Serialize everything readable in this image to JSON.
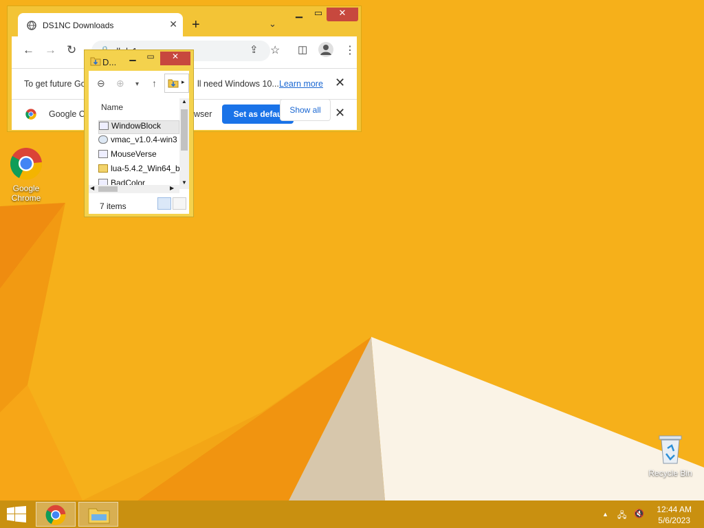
{
  "desktop": {
    "icons": [
      {
        "label": "Google Chrome",
        "icon": "chrome-icon"
      },
      {
        "label": "Recycle Bin",
        "icon": "recycle-bin-icon"
      }
    ]
  },
  "chrome": {
    "tab_title": "DS1NC Downloads",
    "url": "dl.ds1nc.ru",
    "infobar_text": "To get future Go",
    "infobar_text_tail": "ll need Windows 10...",
    "infobar_link": "Learn more",
    "default_bar_text": "Google C",
    "default_bar_text_tail": "wser",
    "set_default_button": "Set as defau",
    "show_all_button": "Show all",
    "new_tab_symbol": "+",
    "close_symbol": "✕"
  },
  "explorer": {
    "title": "D...",
    "column_header": "Name",
    "files": [
      {
        "name": "WindowBlock",
        "type": "app"
      },
      {
        "name": "vmac_v1.0.4-win3",
        "type": "app"
      },
      {
        "name": "MouseVerse",
        "type": "app"
      },
      {
        "name": "lua-5.4.2_Win64_b",
        "type": "zip"
      },
      {
        "name": "BadColor",
        "type": "app"
      }
    ],
    "status": "7 items"
  },
  "taskbar": {
    "time": "12:44 AM",
    "date": "5/6/2023"
  },
  "colors": {
    "wallpaper": "#f6b01a",
    "accent_blue": "#1a73e8",
    "close_red": "#c7483e"
  }
}
